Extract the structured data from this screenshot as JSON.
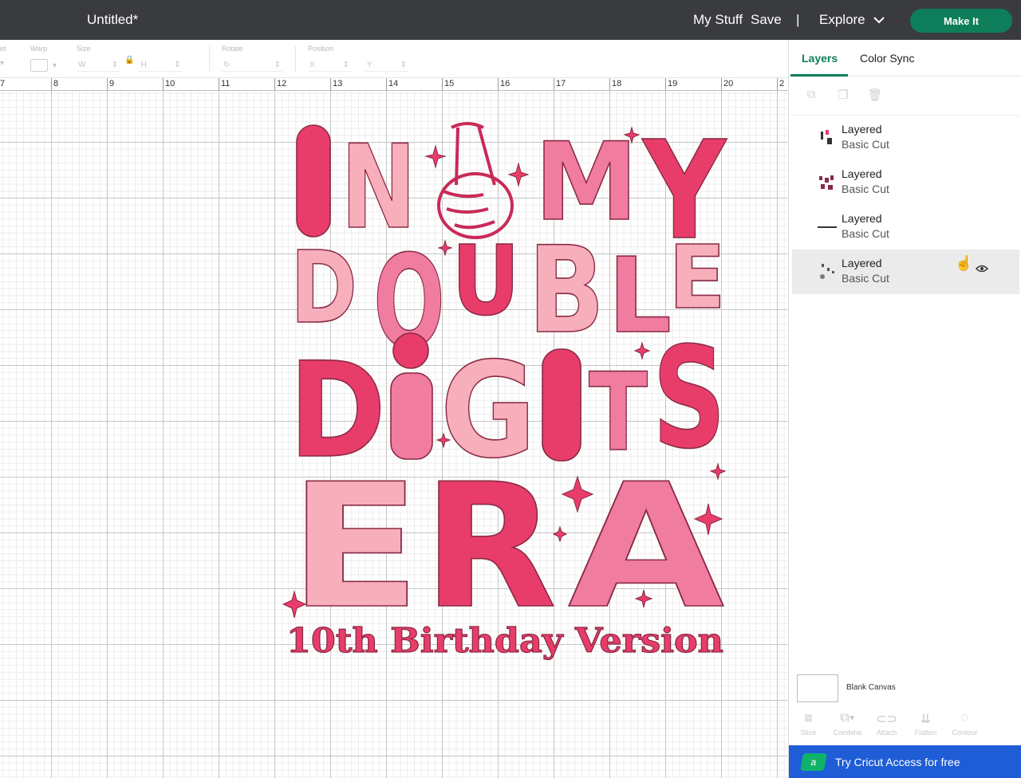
{
  "topbar": {
    "title": "Untitled*",
    "my_stuff": "My Stuff",
    "save": "Save",
    "divider": "|",
    "explore": "Explore",
    "make_it": "Make It"
  },
  "toolbar": {
    "set_label": "et",
    "warp_label": "Warp",
    "size_label": "Size",
    "w_label": "W",
    "h_label": "H",
    "rotate_label": "Rotate",
    "position_label": "Position",
    "x_label": "X",
    "y_label": "Y"
  },
  "ruler": [
    "7",
    "8",
    "9",
    "10",
    "11",
    "12",
    "13",
    "14",
    "15",
    "16",
    "17",
    "18",
    "19",
    "20",
    "2"
  ],
  "panel": {
    "tabs": [
      "Layers",
      "Color Sync"
    ],
    "layers": [
      {
        "name": "Layered",
        "type": "Basic Cut"
      },
      {
        "name": "Layered",
        "type": "Basic Cut"
      },
      {
        "name": "Layered",
        "type": "Basic Cut"
      },
      {
        "name": "Layered",
        "type": "Basic Cut"
      }
    ],
    "canvas_label": "Blank Canvas",
    "tools": [
      "Slice",
      "Combine",
      "Attach",
      "Flatten",
      "Contour"
    ],
    "promo": "Try Cricut Access for free"
  },
  "design": {
    "lines": [
      "IN",
      "MY",
      "DOUBLE",
      "DIGITS",
      "ERA"
    ],
    "subtitle": "10th Birthday Version",
    "colors": {
      "hot": "#e83d6a",
      "mid": "#f07c9f",
      "light": "#f7afbb",
      "outline": "#8a2a44",
      "accent": "#0e7e5a"
    }
  }
}
